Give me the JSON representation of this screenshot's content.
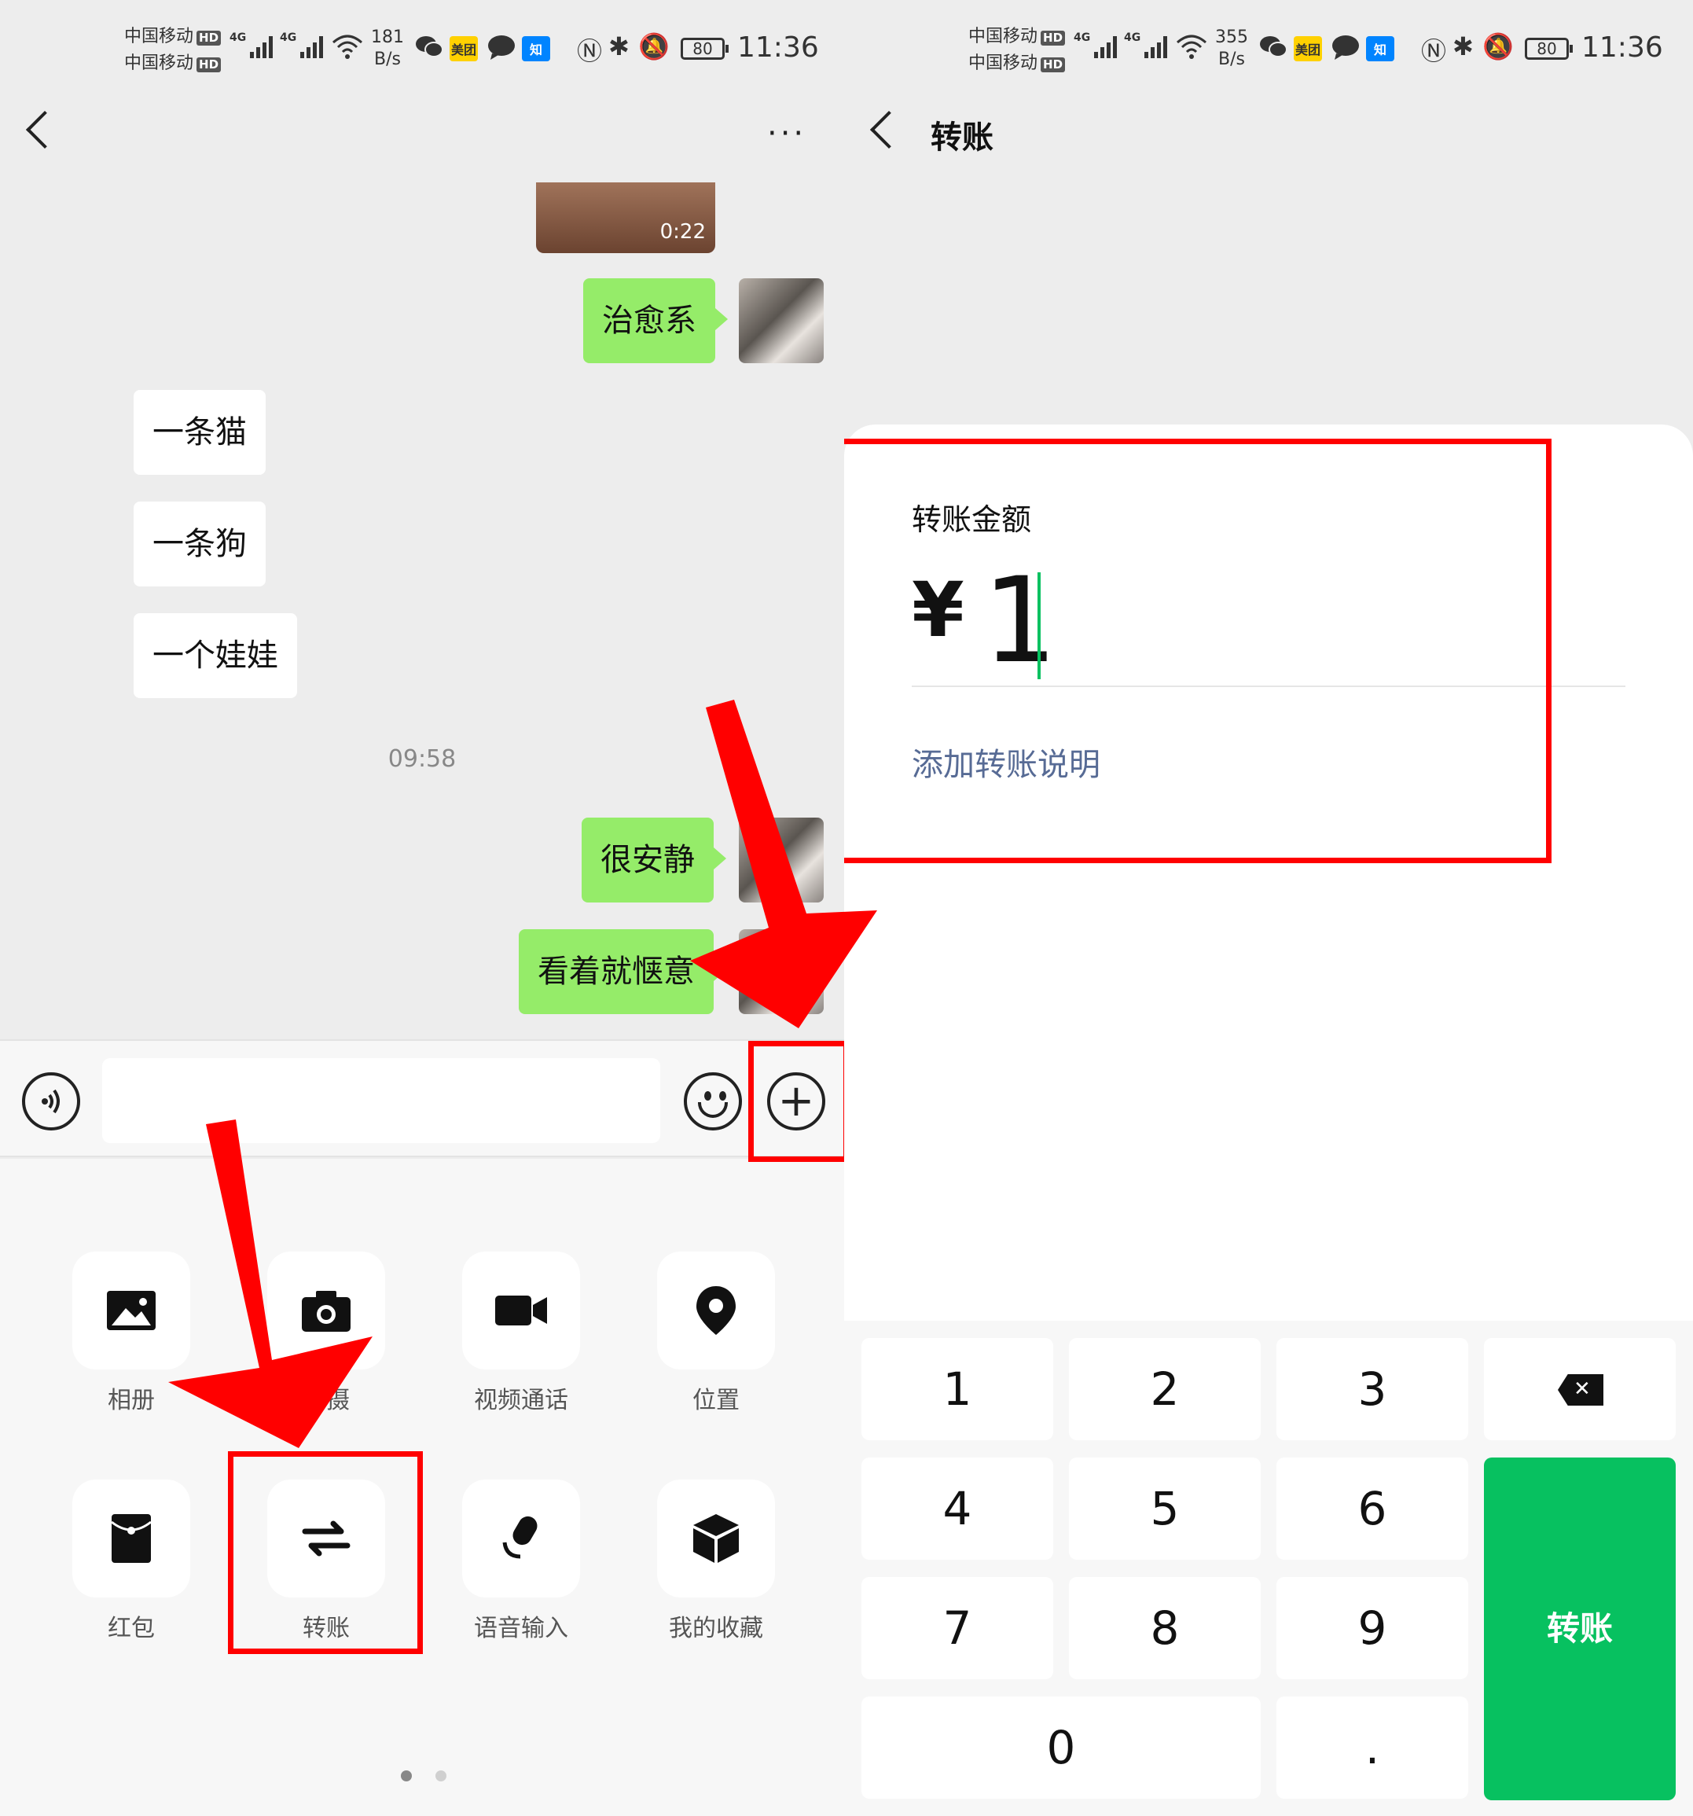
{
  "left": {
    "status": {
      "carrier1": "中国移动",
      "carrier2": "中国移动",
      "hd": "HD",
      "net": "4G",
      "speed_value": "181",
      "speed_unit": "B/s",
      "meituan": "美团",
      "zhihu": "知",
      "battery": "80",
      "time": "11:36"
    },
    "header": {
      "more": "···"
    },
    "chat": {
      "video_duration": "0:22",
      "messages": [
        {
          "side": "me",
          "text": "治愈系"
        },
        {
          "side": "them",
          "text": "一条猫"
        },
        {
          "side": "them",
          "text": "一条狗"
        },
        {
          "side": "them",
          "text": "一个娃娃"
        },
        {
          "side": "me",
          "text": "很安静"
        },
        {
          "side": "me",
          "text": "看着就惬意"
        }
      ],
      "timestamp": "09:58"
    },
    "input": {
      "placeholder": "",
      "plus": "+"
    },
    "more_panel": {
      "items": [
        {
          "label": "相册",
          "icon": "photo-album-icon"
        },
        {
          "label": "拍摄",
          "icon": "camera-icon"
        },
        {
          "label": "视频通话",
          "icon": "video-call-icon"
        },
        {
          "label": "位置",
          "icon": "location-icon"
        },
        {
          "label": "红包",
          "icon": "red-packet-icon"
        },
        {
          "label": "转账",
          "icon": "transfer-icon"
        },
        {
          "label": "语音输入",
          "icon": "microphone-icon"
        },
        {
          "label": "我的收藏",
          "icon": "favorites-icon"
        }
      ],
      "page_count": 2,
      "active_page": 1
    }
  },
  "right": {
    "status": {
      "carrier1": "中国移动",
      "carrier2": "中国移动",
      "hd": "HD",
      "net": "4G",
      "speed_value": "355",
      "speed_unit": "B/s",
      "meituan": "美团",
      "zhihu": "知",
      "battery": "80",
      "time": "11:36"
    },
    "header": {
      "title": "转账"
    },
    "form": {
      "amount_label": "转账金额",
      "currency": "¥",
      "amount": "1",
      "add_note": "添加转账说明"
    },
    "keypad": {
      "keys": [
        "1",
        "2",
        "3",
        "4",
        "5",
        "6",
        "7",
        "8",
        "9",
        "0",
        "."
      ],
      "confirm": "转账"
    }
  },
  "colors": {
    "wechat_green": "#07c160",
    "bubble_green": "#95ec69",
    "link_blue": "#576b95",
    "annotation_red": "#ff0000"
  }
}
